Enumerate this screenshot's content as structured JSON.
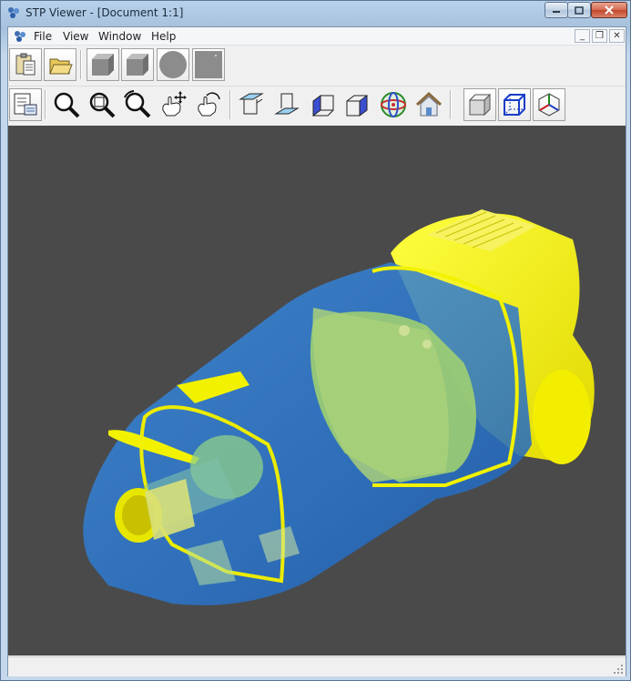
{
  "window": {
    "title": "STP Viewer - [Document 1:1]",
    "min_label": "─",
    "max_label": "□",
    "close_label": "✕"
  },
  "menubar": {
    "items": [
      {
        "label": "File"
      },
      {
        "label": "View"
      },
      {
        "label": "Window"
      },
      {
        "label": "Help"
      }
    ],
    "mdi_min": "_",
    "mdi_restore": "❐",
    "mdi_close": "✕"
  },
  "toolbar_top": [
    {
      "icon": "paste-icon"
    },
    {
      "icon": "open-folder-icon"
    },
    {
      "icon": "shaded-box-icon"
    },
    {
      "icon": "shaded-box-icon-2"
    },
    {
      "icon": "circle-shape-icon"
    },
    {
      "icon": "square-shape-icon"
    }
  ],
  "toolbar_view": [
    {
      "icon": "properties-icon"
    },
    {
      "icon": "zoom-icon"
    },
    {
      "icon": "zoom-window-icon"
    },
    {
      "icon": "zoom-rotate-icon"
    },
    {
      "icon": "pan-hand-icon"
    },
    {
      "icon": "rotate-hand-icon"
    },
    {
      "icon": "view-top-icon"
    },
    {
      "icon": "view-bottom-icon"
    },
    {
      "icon": "view-left-icon"
    },
    {
      "icon": "view-right-icon"
    },
    {
      "icon": "view-axo-icon"
    },
    {
      "icon": "home-icon"
    },
    {
      "icon": "shaded-mode-icon"
    },
    {
      "icon": "wireframe-mode-icon"
    },
    {
      "icon": "axis-triad-icon"
    }
  ],
  "colors": {
    "viewport_bg": "#4a4a4a",
    "part_blue": "#2f7fd6",
    "part_yellow": "#f2f200"
  }
}
